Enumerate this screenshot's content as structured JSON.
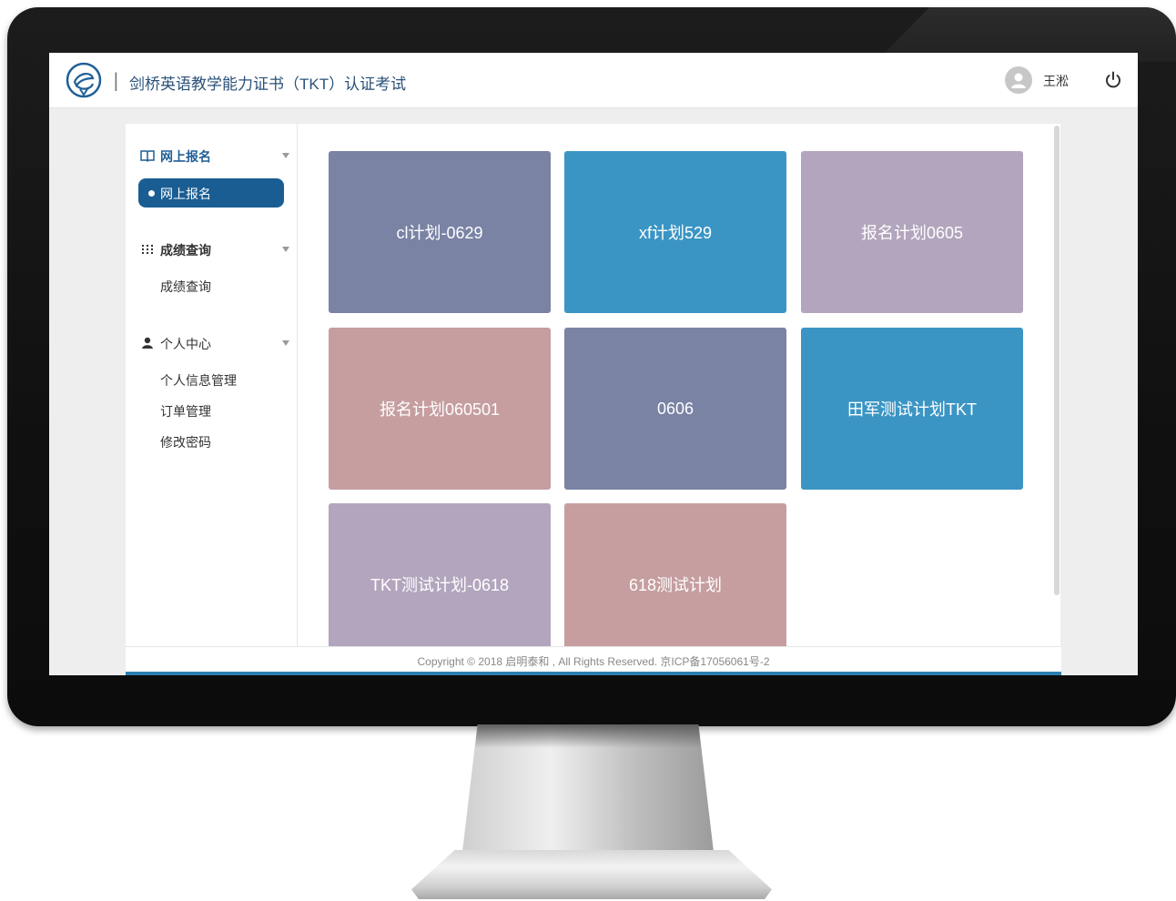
{
  "header": {
    "title": "剑桥英语教学能力证书（TKT）认证考试",
    "separator": "|",
    "user_name": "王淞",
    "icons": [
      "logo-icon",
      "user-avatar-icon",
      "power-icon"
    ]
  },
  "sidebar": {
    "groups": [
      {
        "label": "网上报名",
        "icon": "book-icon",
        "active": true,
        "items": [
          {
            "label": "网上报名",
            "active": true
          }
        ]
      },
      {
        "label": "成绩查询",
        "icon": "grid-icon",
        "active": false,
        "items": [
          {
            "label": "成绩查询",
            "active": false
          }
        ]
      },
      {
        "label": "个人中心",
        "icon": "person-icon",
        "active": false,
        "items": [
          {
            "label": "个人信息管理",
            "active": false
          },
          {
            "label": "订单管理",
            "active": false
          },
          {
            "label": "修改密码",
            "active": false
          }
        ]
      }
    ]
  },
  "plans": [
    {
      "name": "cl计划-0629",
      "color": "#7a83a4"
    },
    {
      "name": "xf计划529",
      "color": "#3b95c4"
    },
    {
      "name": "报名计划0605",
      "color": "#b3a5bd"
    },
    {
      "name": "报名计划060501",
      "color": "#c69e9f"
    },
    {
      "name": "0606",
      "color": "#7a83a4"
    },
    {
      "name": "田军测试计划TKT",
      "color": "#3b95c4"
    },
    {
      "name": "TKT测试计划-0618",
      "color": "#b3a5bd"
    },
    {
      "name": "618测试计划",
      "color": "#c69e9f"
    }
  ],
  "footer": {
    "text": "Copyright © 2018 启明泰和 , All Rights Reserved. 京ICP备17056061号-2"
  },
  "colors": {
    "accent": "#1a5d93",
    "title": "#2a5178"
  }
}
